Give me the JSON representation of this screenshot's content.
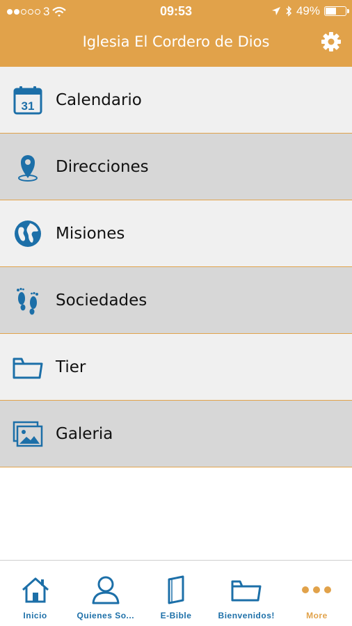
{
  "status": {
    "carrier": "3",
    "time": "09:53",
    "battery": "49%",
    "battery_fraction": 0.49
  },
  "header": {
    "title": "Iglesia El Cordero de Dios",
    "settings_icon": "gear-icon"
  },
  "menu": {
    "items": [
      {
        "label": "Calendario",
        "icon": "calendar-icon",
        "icon_text": "31"
      },
      {
        "label": "Direcciones",
        "icon": "map-pin-icon"
      },
      {
        "label": "Misiones",
        "icon": "globe-icon"
      },
      {
        "label": "Sociedades",
        "icon": "footprints-icon"
      },
      {
        "label": "Tier",
        "icon": "folder-icon"
      },
      {
        "label": "Galeria",
        "icon": "gallery-icon"
      }
    ]
  },
  "tabs": [
    {
      "label": "Inicio",
      "icon": "home-icon"
    },
    {
      "label": "Quienes So...",
      "icon": "person-icon"
    },
    {
      "label": "E-Bible",
      "icon": "book-icon"
    },
    {
      "label": "Bienvenidos!",
      "icon": "folder-icon"
    },
    {
      "label": "More",
      "icon": "more-icon",
      "active": true
    }
  ],
  "colors": {
    "accent": "#E1A24A",
    "icon_blue": "#1C6FA8",
    "row_light": "#F0F0F0",
    "row_dark": "#D7D7D7"
  }
}
